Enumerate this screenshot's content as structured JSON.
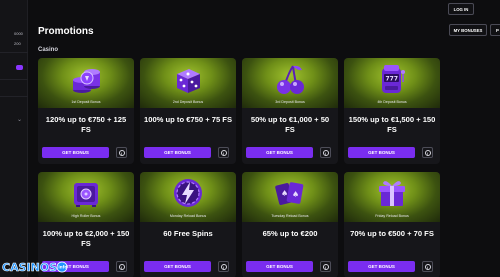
{
  "sidebar": {
    "counter_top": "0000",
    "counter_bottom": "200"
  },
  "header": {
    "login_label": "LOG IN"
  },
  "page": {
    "title": "Promotions",
    "my_bonuses_label": "MY BONUSES",
    "cut_button_label": "P",
    "section_label": "Casino"
  },
  "cards": [
    {
      "tag": "1st Deposit Bonus",
      "title": "120% up to €750 + 125 FS",
      "cta": "GET BONUS",
      "icon": "chip-stack-icon"
    },
    {
      "tag": "2nd Deposit Bonus",
      "title": "100% up to €750 + 75 FS",
      "cta": "GET BONUS",
      "icon": "dice-icon"
    },
    {
      "tag": "3rd Deposit Bonus",
      "title": "50% up to €1,000 + 50 FS",
      "cta": "GET BONUS",
      "icon": "cherries-icon"
    },
    {
      "tag": "4th Deposit Bonus",
      "title": "150% up to €1,500 + 150 FS",
      "cta": "GET BONUS",
      "icon": "slot-machine-icon"
    },
    {
      "tag": "High Roller Bonus",
      "title": "100% up to €2,000 + 150 FS",
      "cta": "GET BONUS",
      "icon": "safe-icon"
    },
    {
      "tag": "Monday Reload Bonus",
      "title": "60 Free Spins",
      "cta": "GET BONUS",
      "icon": "lightning-chip-icon"
    },
    {
      "tag": "Tuesday Reload Bonus",
      "title": "65% up to €200",
      "cta": "GET BONUS",
      "icon": "playing-cards-icon"
    },
    {
      "tag": "Friday Reload Bonus",
      "title": "70% up to €500 + 70 FS",
      "cta": "GET BONUS",
      "icon": "gift-box-icon"
    }
  ],
  "watermark": {
    "text": "CASINOS",
    "suffix": "info"
  },
  "colors": {
    "accent": "#7a2df0",
    "background": "#0d0d0f",
    "card": "#16161a",
    "card_image_green": "#6f8f18"
  }
}
